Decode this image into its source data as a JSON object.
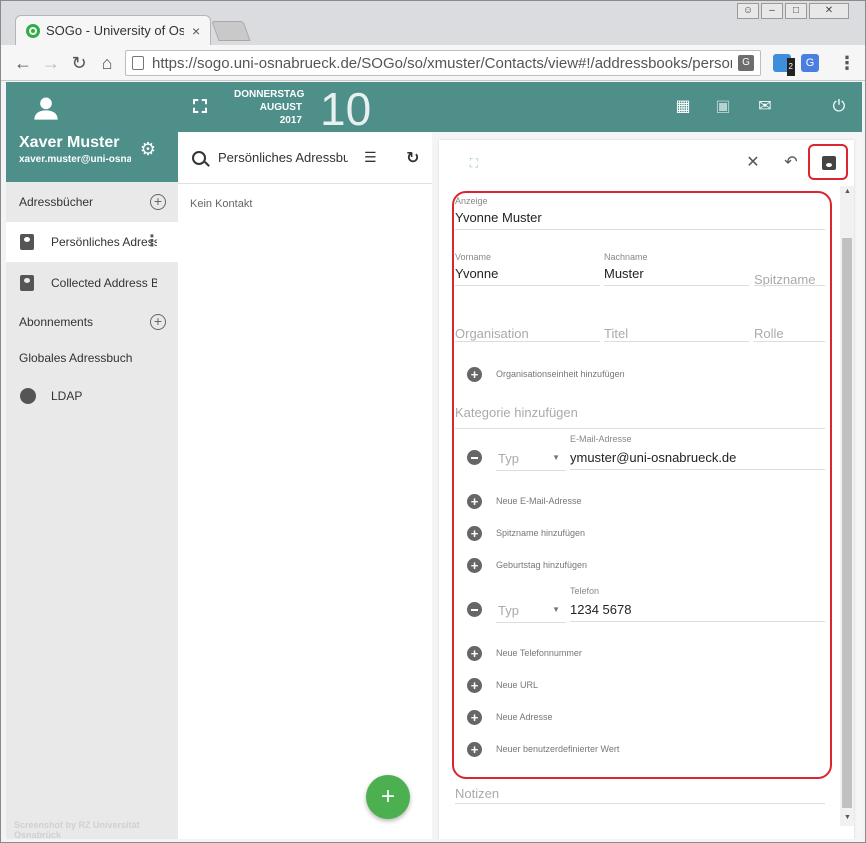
{
  "browser": {
    "tab_title": "SOGo - University of Osnabrück",
    "tab_close": "×",
    "url": "https://sogo.uni-osnabrueck.de/SOGo/so/xmuster/Contacts/view#!/addressbooks/personal",
    "ext_badge": "2"
  },
  "user": {
    "name": "Xaver Muster",
    "email": "xaver.muster@uni-osnabrueck.de"
  },
  "sidebar": {
    "addressbooks_label": "Adressbücher",
    "items": [
      {
        "label": "Persönliches Adressbuch"
      },
      {
        "label": "Collected Address Book"
      }
    ],
    "subscriptions_label": "Abonnements",
    "global_label": "Globales Adressbuch",
    "ldap_label": "LDAP",
    "watermark": "Screenshot by RZ Universität Osnabrück"
  },
  "topbar": {
    "weekday": "DONNERSTAG",
    "month": "AUGUST",
    "year": "2017",
    "day": "10"
  },
  "list": {
    "title": "Persönliches Adressbuch",
    "empty": "Kein Kontakt",
    "fab": "+"
  },
  "contact": {
    "display_label": "Anzeige",
    "display_value": "Yvonne Muster",
    "first_label": "Vorname",
    "first_value": "Yvonne",
    "last_label": "Nachname",
    "last_value": "Muster",
    "nickname_placeholder": "Spitzname",
    "org_placeholder": "Organisation",
    "title_placeholder": "Titel",
    "role_placeholder": "Rolle",
    "add_orgunit": "Organisationseinheit hinzufügen",
    "category_placeholder": "Kategorie hinzufügen",
    "type_placeholder": "Typ",
    "email_label": "E-Mail-Adresse",
    "email_value": "ymuster@uni-osnabrueck.de",
    "add_email": "Neue E-Mail-Adresse",
    "add_nickname": "Spitzname hinzufügen",
    "add_birthday": "Geburtstag hinzufügen",
    "phone_label": "Telefon",
    "phone_value": "1234 5678",
    "add_phone": "Neue Telefonnummer",
    "add_url": "Neue URL",
    "add_address": "Neue Adresse",
    "add_custom": "Neuer benutzerdefinierter Wert",
    "notes_placeholder": "Notizen"
  },
  "colors": {
    "primary": "#4e8f8a",
    "fab": "#4caf50",
    "highlight": "#d9262f"
  }
}
